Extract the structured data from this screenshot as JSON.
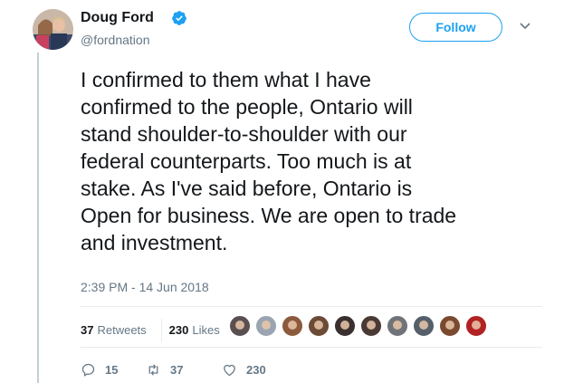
{
  "author": {
    "name": "Doug Ford",
    "handle": "@fordnation",
    "verified": true
  },
  "follow_button": {
    "label": "Follow"
  },
  "tweet": {
    "text": "I confirmed to them what I have\nconfirmed to the people, Ontario will\nstand shoulder-to-shoulder with our\nfederal counterparts. Too much is at\nstake. As I've said before, Ontario is\nOpen for business. We are open to trade\nand investment.",
    "timestamp": "2:39 PM - 14 Jun 2018"
  },
  "stats": {
    "retweets_count": "37",
    "retweets_label": "Retweets",
    "likes_count": "230",
    "likes_label": "Likes"
  },
  "likers": [
    {
      "name": "liker-1",
      "color": "#5a5050"
    },
    {
      "name": "liker-2",
      "color": "#9aa5b1"
    },
    {
      "name": "liker-3",
      "color": "#8c5a3c"
    },
    {
      "name": "liker-4",
      "color": "#6b4a36"
    },
    {
      "name": "liker-5",
      "color": "#3a3030"
    },
    {
      "name": "liker-6",
      "color": "#4a3a35"
    },
    {
      "name": "liker-7",
      "color": "#707478"
    },
    {
      "name": "liker-8",
      "color": "#55606a"
    },
    {
      "name": "liker-9",
      "color": "#7a4a30"
    },
    {
      "name": "liker-10",
      "color": "#b22222"
    }
  ],
  "actions": {
    "reply_count": "15",
    "retweet_count": "37",
    "like_count": "230"
  },
  "colors": {
    "accent": "#1da1f2",
    "text": "#14171a",
    "muted": "#657786",
    "border": "#e6ecf0"
  }
}
